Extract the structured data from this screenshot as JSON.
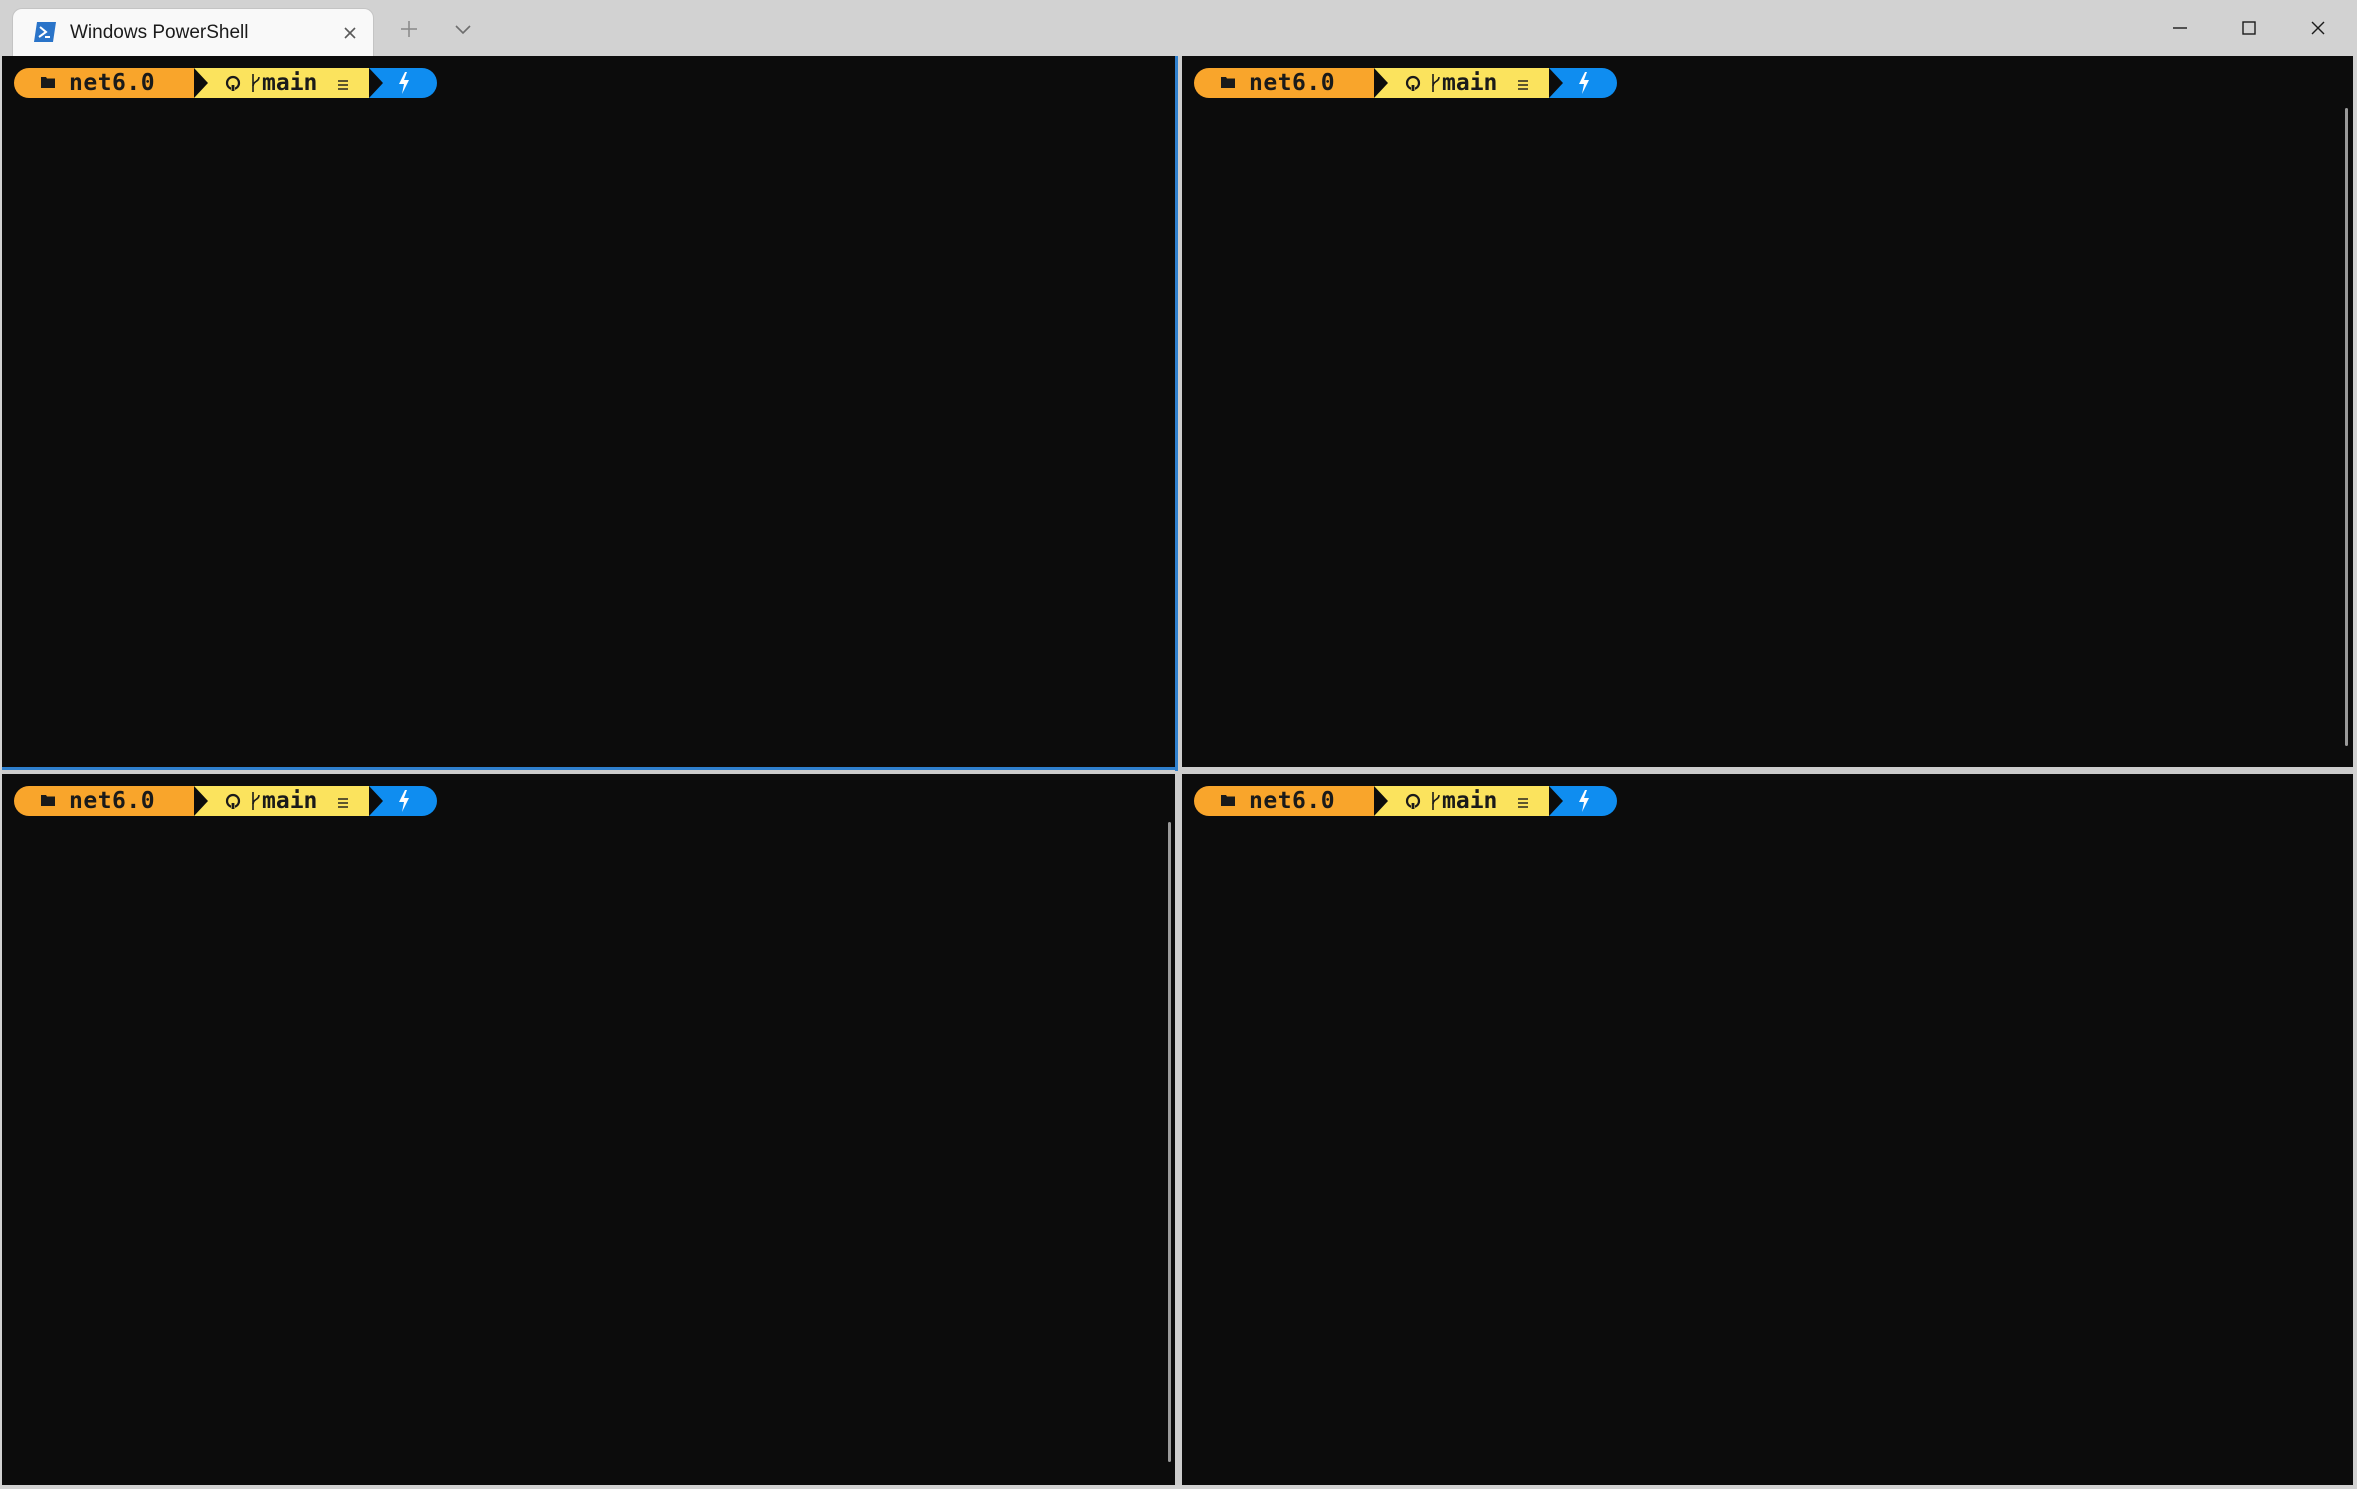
{
  "window": {
    "tab_title": "Windows PowerShell",
    "tab_icon": "powershell-icon",
    "controls": [
      "minimize-icon",
      "maximize-icon",
      "close-icon"
    ],
    "accent_color": "#2f80ce"
  },
  "panes": [
    {
      "position": "top-left",
      "active": true,
      "prompt": {
        "folder": "net6.0",
        "branch": "main",
        "branch_status": "≡"
      }
    },
    {
      "position": "top-right",
      "active": false,
      "prompt": {
        "folder": "net6.0",
        "branch": "main",
        "branch_status": "≡"
      }
    },
    {
      "position": "bottom-left",
      "active": false,
      "prompt": {
        "folder": "net6.0",
        "branch": "main",
        "branch_status": "≡"
      }
    },
    {
      "position": "bottom-right",
      "active": false,
      "prompt": {
        "folder": "net6.0",
        "branch": "main",
        "branch_status": "≡"
      }
    }
  ],
  "prompt_colors": {
    "folder": "#f9a52b",
    "git": "#fbe35d",
    "status": "#0f8df0"
  }
}
